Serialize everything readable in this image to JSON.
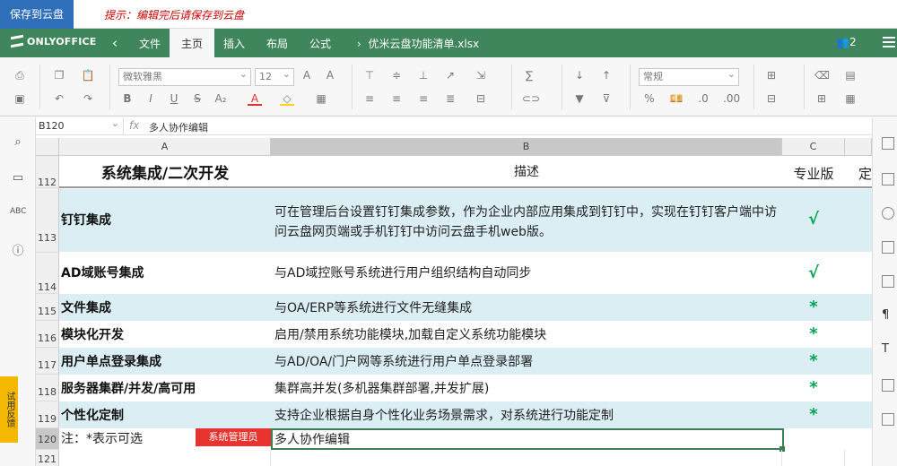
{
  "app": {
    "save_button": "保存到云盘",
    "hint": "提示：编辑完后请保存到云盘",
    "logo": "ONLYOFFICE",
    "tabs": [
      "文件",
      "主页",
      "插入",
      "布局",
      "公式"
    ],
    "active_tab": "主页",
    "doc_title": "优米云盘功能清单.xlsx",
    "user_count": "2"
  },
  "toolbar": {
    "font_name": "微软雅黑",
    "font_size": "12",
    "number_format": "常规"
  },
  "formula_bar": {
    "cell_ref": "B120",
    "fx": "fx",
    "value": "多人协作编辑"
  },
  "left_panel": {
    "feedback": "试用反馈"
  },
  "columns": [
    "A",
    "B",
    "C"
  ],
  "rows": [
    {
      "num": "112",
      "a": "系统集成/二次开发",
      "b": "描述",
      "c": "专业版",
      "d": "定"
    },
    {
      "num": "113",
      "a": "钉钉集成",
      "b": "可在管理后台设置钉钉集成参数，作为企业内部应用集成到钉钉中，实现在钉钉客户端中访问云盘网页端或手机钉钉中访问云盘手机web版。",
      "c": "√"
    },
    {
      "num": "114",
      "a": "AD域账号集成",
      "b": "与AD域控账号系统进行用户组织结构自动同步",
      "c": "√"
    },
    {
      "num": "115",
      "a": "文件集成",
      "b": "与OA/ERP等系统进行文件无缝集成",
      "c": "*"
    },
    {
      "num": "116",
      "a": "模块化开发",
      "b": "启用/禁用系统功能模块,加载自定义系统功能模块",
      "c": "*"
    },
    {
      "num": "117",
      "a": "用户单点登录集成",
      "b": "与AD/OA/门户网等系统进行用户单点登录部署",
      "c": "*"
    },
    {
      "num": "118",
      "a": "服务器集群/并发/高可用",
      "b": "集群高并发(多机器集群部署,并发扩展)",
      "c": "*"
    },
    {
      "num": "119",
      "a": "个性化定制",
      "b": "支持企业根据自身个性化业务场景需求，对系统进行功能定制",
      "c": "*"
    },
    {
      "num": "120",
      "a": "注：*表示可选",
      "b": "多人协作编辑",
      "c": ""
    },
    {
      "num": "121",
      "a": "",
      "b": "",
      "c": ""
    }
  ],
  "collab_badge": "系统管理员"
}
